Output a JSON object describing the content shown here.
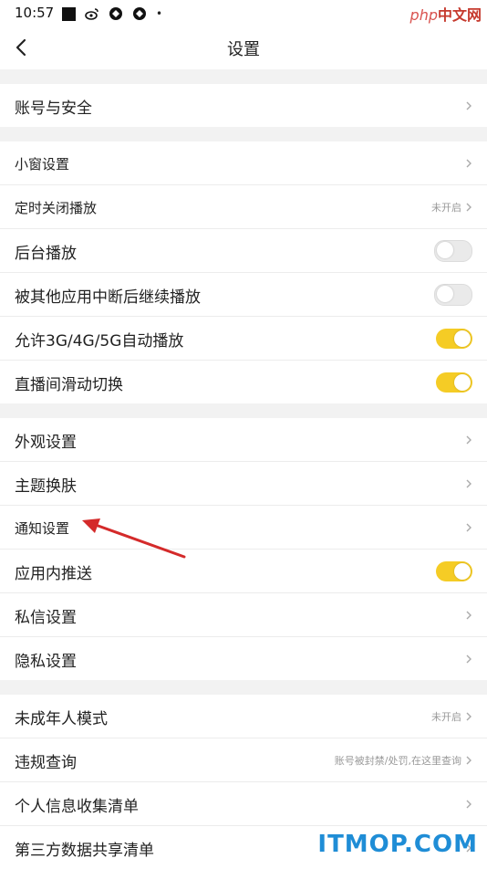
{
  "status_bar": {
    "time": "10:57",
    "dot": "•"
  },
  "watermark_top": {
    "php": "php",
    "cn": "中文网"
  },
  "nav": {
    "title": "设置"
  },
  "groups": [
    {
      "rows": [
        {
          "label": "账号与安全",
          "type": "link"
        }
      ]
    },
    {
      "rows": [
        {
          "label": "小窗设置",
          "type": "link"
        },
        {
          "label": "定时关闭播放",
          "type": "link",
          "hint": "未开启"
        },
        {
          "label": "后台播放",
          "type": "toggle",
          "on": false
        },
        {
          "label": "被其他应用中断后继续播放",
          "type": "toggle",
          "on": false
        },
        {
          "label": "允许3G/4G/5G自动播放",
          "type": "toggle",
          "on": true
        },
        {
          "label": "直播间滑动切换",
          "type": "toggle",
          "on": true
        }
      ]
    },
    {
      "rows": [
        {
          "label": "外观设置",
          "type": "link"
        },
        {
          "label": "主题换肤",
          "type": "link"
        },
        {
          "label": "通知设置",
          "type": "link"
        },
        {
          "label": "应用内推送",
          "type": "toggle",
          "on": true
        },
        {
          "label": "私信设置",
          "type": "link"
        },
        {
          "label": "隐私设置",
          "type": "link"
        }
      ]
    },
    {
      "rows": [
        {
          "label": "未成年人模式",
          "type": "link",
          "hint": "未开启"
        },
        {
          "label": "违规查询",
          "type": "link",
          "hint": "账号被封禁/处罚,在这里查询"
        },
        {
          "label": "个人信息收集清单",
          "type": "link"
        },
        {
          "label": "第三方数据共享清单",
          "type": "link"
        }
      ]
    }
  ],
  "colors": {
    "toggle_on": "#f5cc25",
    "annotation_arrow": "#d42a2a",
    "watermark": "#1f8dd6"
  },
  "watermark_bottom": "ITMOP.COM"
}
